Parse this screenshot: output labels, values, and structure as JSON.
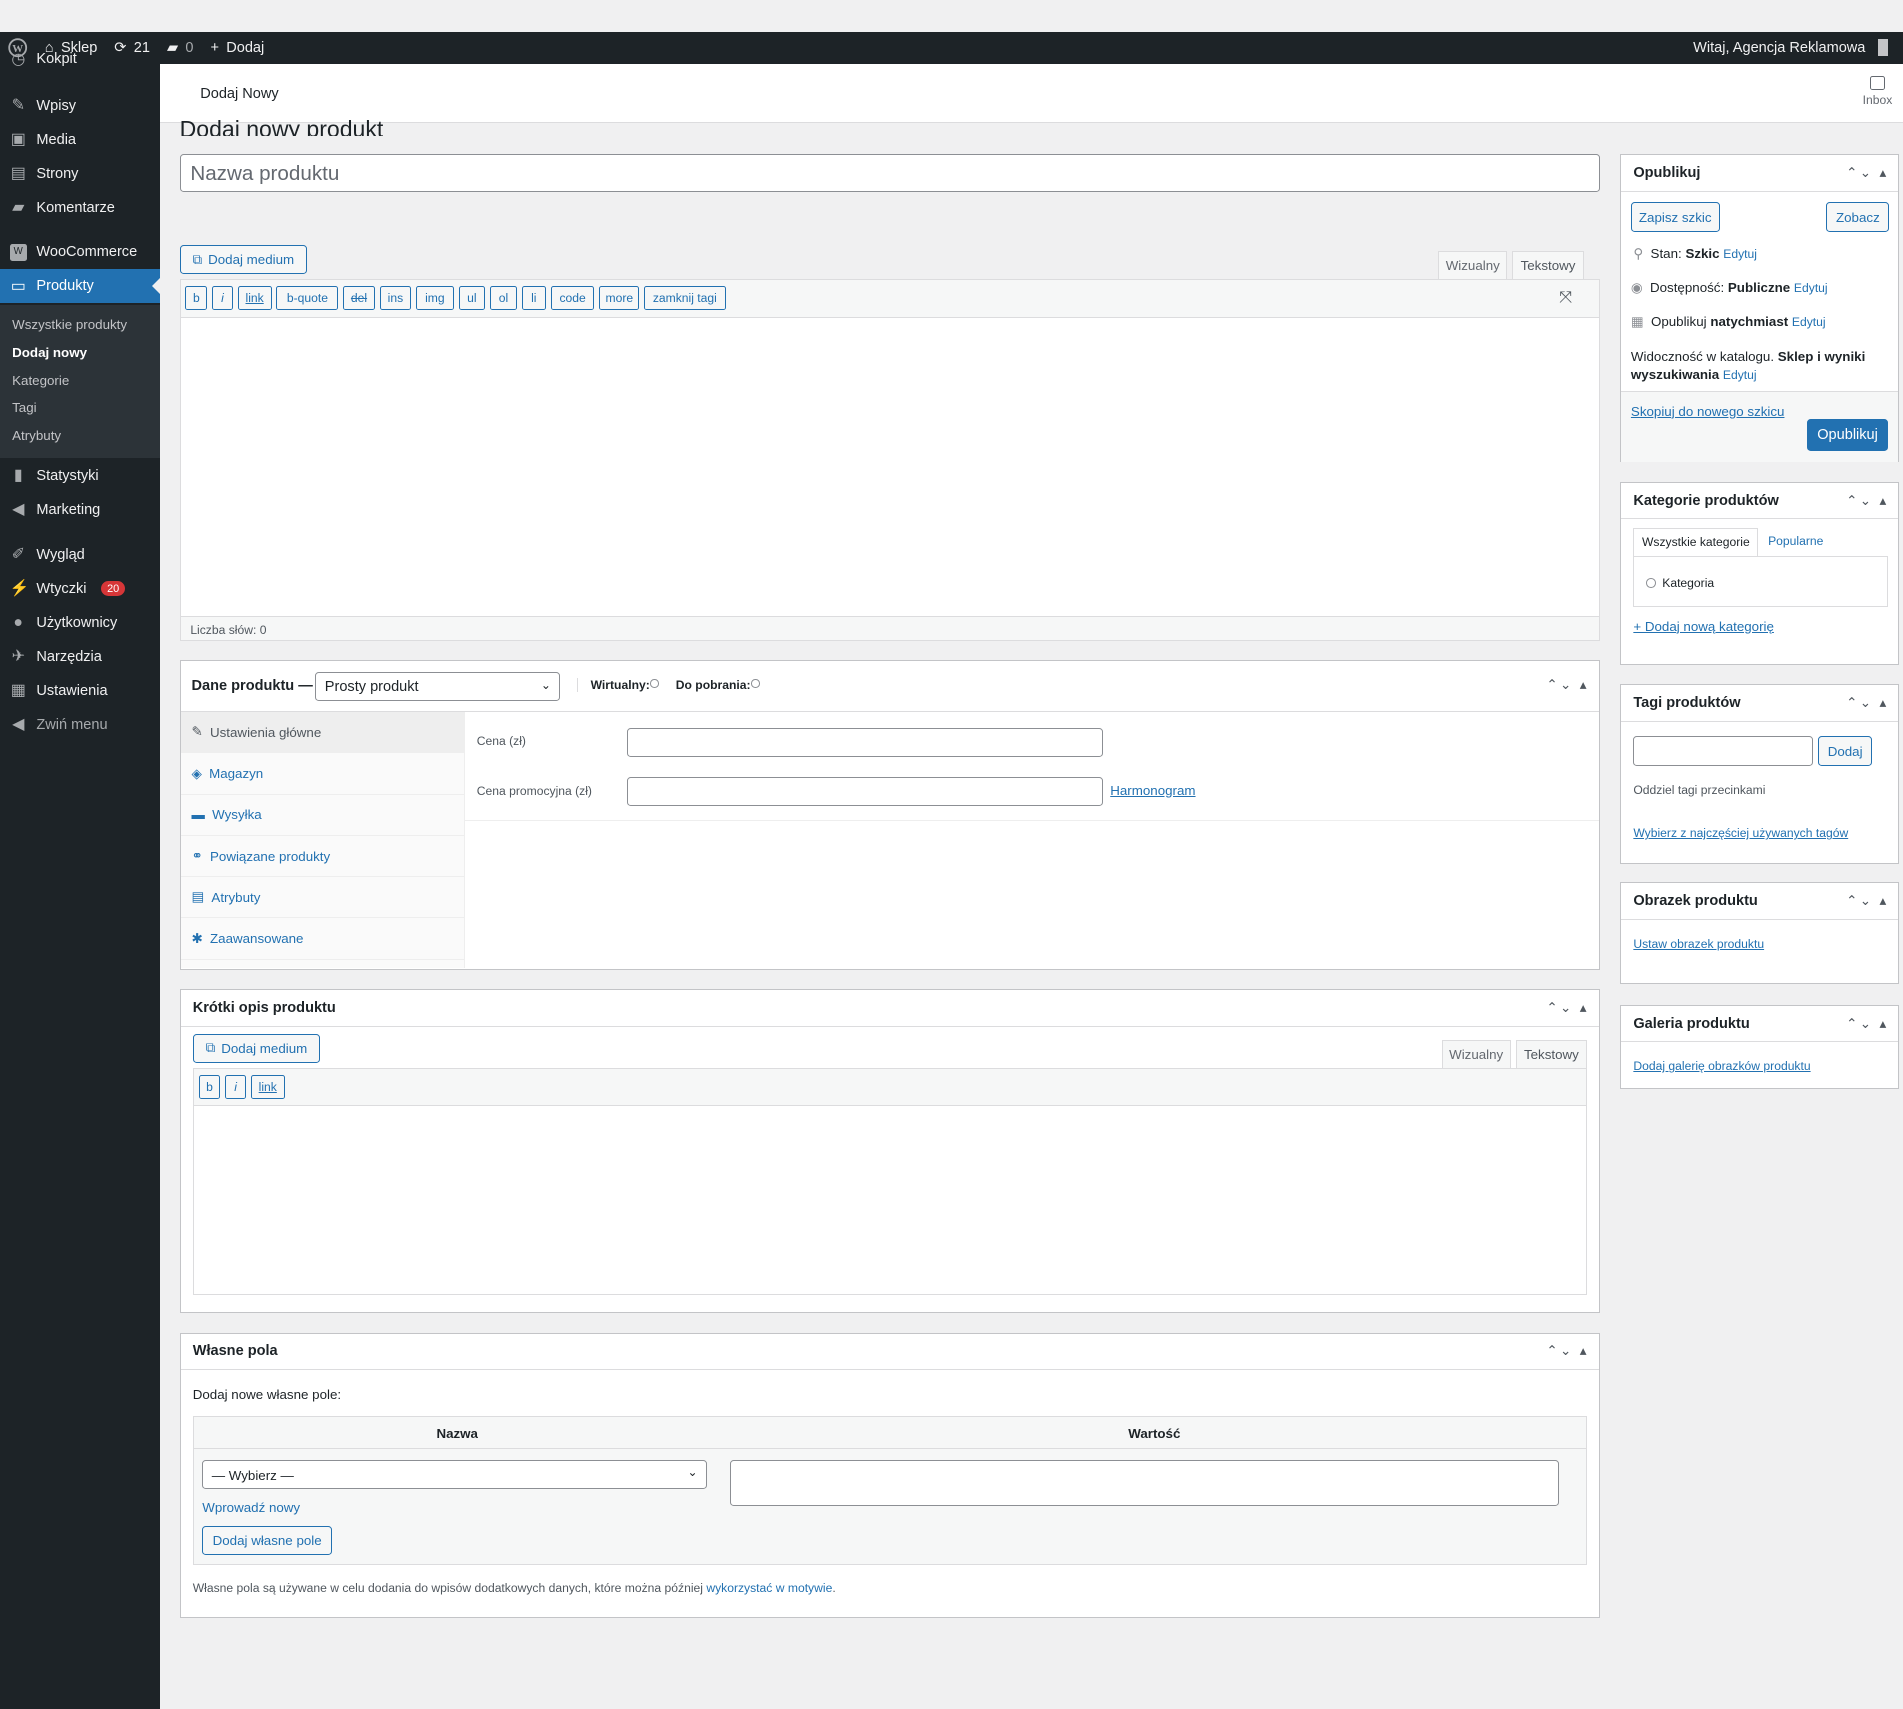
{
  "admin_bar": {
    "site": "Sklep",
    "updates": "21",
    "comments": "0",
    "new_label": "Dodaj",
    "greeting": "Witaj, Agencja Reklamowa"
  },
  "sidebar": {
    "items": [
      {
        "label": "Kokpit",
        "icon": "dashboard-icon"
      },
      {
        "label": "Wpisy",
        "icon": "pin-icon"
      },
      {
        "label": "Media",
        "icon": "media-icon"
      },
      {
        "label": "Strony",
        "icon": "page-icon"
      },
      {
        "label": "Komentarze",
        "icon": "comment-icon"
      },
      {
        "label": "WooCommerce",
        "icon": "woo-icon"
      },
      {
        "label": "Produkty",
        "icon": "archive-icon"
      },
      {
        "label": "Statystyki",
        "icon": "chart-icon"
      },
      {
        "label": "Marketing",
        "icon": "megaphone-icon"
      },
      {
        "label": "Wygląd",
        "icon": "brush-icon"
      },
      {
        "label": "Wtyczki",
        "icon": "plugin-icon",
        "badge": "20"
      },
      {
        "label": "Użytkownicy",
        "icon": "user-icon"
      },
      {
        "label": "Narzędzia",
        "icon": "wrench-icon"
      },
      {
        "label": "Ustawienia",
        "icon": "settings-icon"
      },
      {
        "label": "Zwiń menu",
        "icon": "collapse-icon"
      }
    ],
    "submenu": [
      "Wszystkie produkty",
      "Dodaj nowy",
      "Kategorie",
      "Tagi",
      "Atrybuty"
    ]
  },
  "subheader": {
    "title": "Dodaj Nowy",
    "inbox": "Inbox"
  },
  "page": {
    "title": "Dodaj nowy produkt",
    "name_placeholder": "Nazwa produktu"
  },
  "editor": {
    "add_media": "Dodaj medium",
    "tab_visual": "Wizualny",
    "tab_text": "Tekstowy",
    "buttons": [
      "b",
      "i",
      "link",
      "b-quote",
      "del",
      "ins",
      "img",
      "ul",
      "ol",
      "li",
      "code",
      "more",
      "zamknij tagi"
    ],
    "word_count": "Liczba słów: 0"
  },
  "product_data": {
    "title": "Dane produktu —",
    "type": "Prosty produkt",
    "virtual": "Wirtualny:",
    "download": "Do pobrania:",
    "tabs": [
      "Ustawienia główne",
      "Magazyn",
      "Wysyłka",
      "Powiązane produkty",
      "Atrybuty",
      "Zaawansowane"
    ],
    "price_label": "Cena (zł)",
    "sale_label": "Cena promocyjna (zł)",
    "schedule": "Harmonogram"
  },
  "short_desc": {
    "title": "Krótki opis produktu",
    "add_media": "Dodaj medium",
    "tab_visual": "Wizualny",
    "tab_text": "Tekstowy",
    "buttons": [
      "b",
      "i",
      "link"
    ]
  },
  "custom_fields": {
    "title": "Własne pola",
    "add_new": "Dodaj nowe własne pole:",
    "col_name": "Nazwa",
    "col_value": "Wartość",
    "select": "— Wybierz —",
    "enter_new": "Wprowadź nowy",
    "add_button": "Dodaj własne pole",
    "note": "Własne pola są używane w celu dodania do wpisów dodatkowych danych, które można później",
    "note_link": "wykorzystać w motywie"
  },
  "publish": {
    "title": "Opublikuj",
    "save_draft": "Zapisz szkic",
    "preview": "Zobacz",
    "status_label": "Stan:",
    "status_value": "Szkic",
    "visibility_label": "Dostępność:",
    "visibility_value": "Publiczne",
    "publish_label": "Opublikuj",
    "publish_value": "natychmiast",
    "edit": "Edytuj",
    "catalog_label": "Widoczność w katalogu.",
    "catalog_value": "Sklep i wyniki wyszukiwania",
    "copy_draft": "Skopiuj do nowego szkicu",
    "publish_button": "Opublikuj"
  },
  "categories": {
    "title": "Kategorie produktów",
    "tab_all": "Wszystkie kategorie",
    "tab_popular": "Popularne",
    "item": "Kategoria",
    "add_new": "+ Dodaj nową kategorię"
  },
  "tags": {
    "title": "Tagi produktów",
    "add": "Dodaj",
    "hint": "Oddziel tagi przecinkami",
    "choose": "Wybierz z najczęściej używanych tagów"
  },
  "image": {
    "title": "Obrazek produktu",
    "set": "Ustaw obrazek produktu"
  },
  "gallery": {
    "title": "Galeria produktu",
    "add": "Dodaj galerię obrazków produktu"
  }
}
